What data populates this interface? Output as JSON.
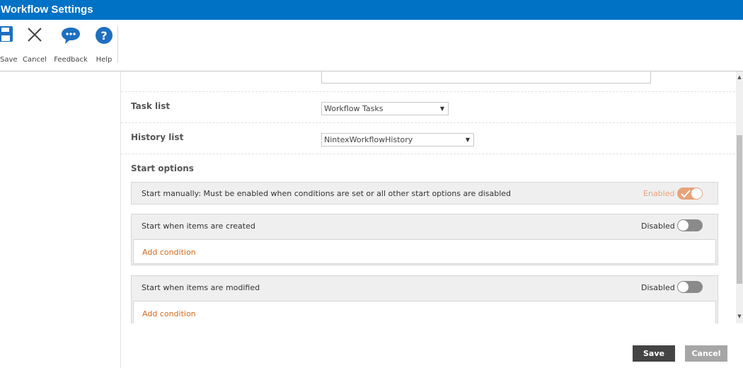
{
  "window": {
    "title": "Workflow Settings"
  },
  "ribbon": {
    "save_label": "Save",
    "cancel_label": "Cancel",
    "feedback_label": "Feedback",
    "help_label": "Help"
  },
  "form": {
    "task_list": {
      "label": "Task list",
      "value": "Workflow Tasks"
    },
    "history_list": {
      "label": "History list",
      "value": "NintexWorkflowHistory"
    },
    "start_options_label": "Start options",
    "start_manually": {
      "text": "Start manually: Must be enabled when conditions are set or all other start options are disabled",
      "state": "Enabled"
    },
    "start_created": {
      "text": "Start when items are created",
      "state": "Disabled",
      "add_condition": "Add condition"
    },
    "start_modified": {
      "text": "Start when items are modified",
      "state": "Disabled",
      "add_condition": "Add condition"
    }
  },
  "footer": {
    "save_label": "Save",
    "cancel_label": "Cancel"
  },
  "colors": {
    "title_bar": "#0072c6",
    "enabled_toggle": "#e8a27a",
    "disabled_toggle": "#8a8a8a",
    "link": "#d2691e",
    "save_button": "#444444",
    "cancel_button": "#a6a6a6"
  }
}
